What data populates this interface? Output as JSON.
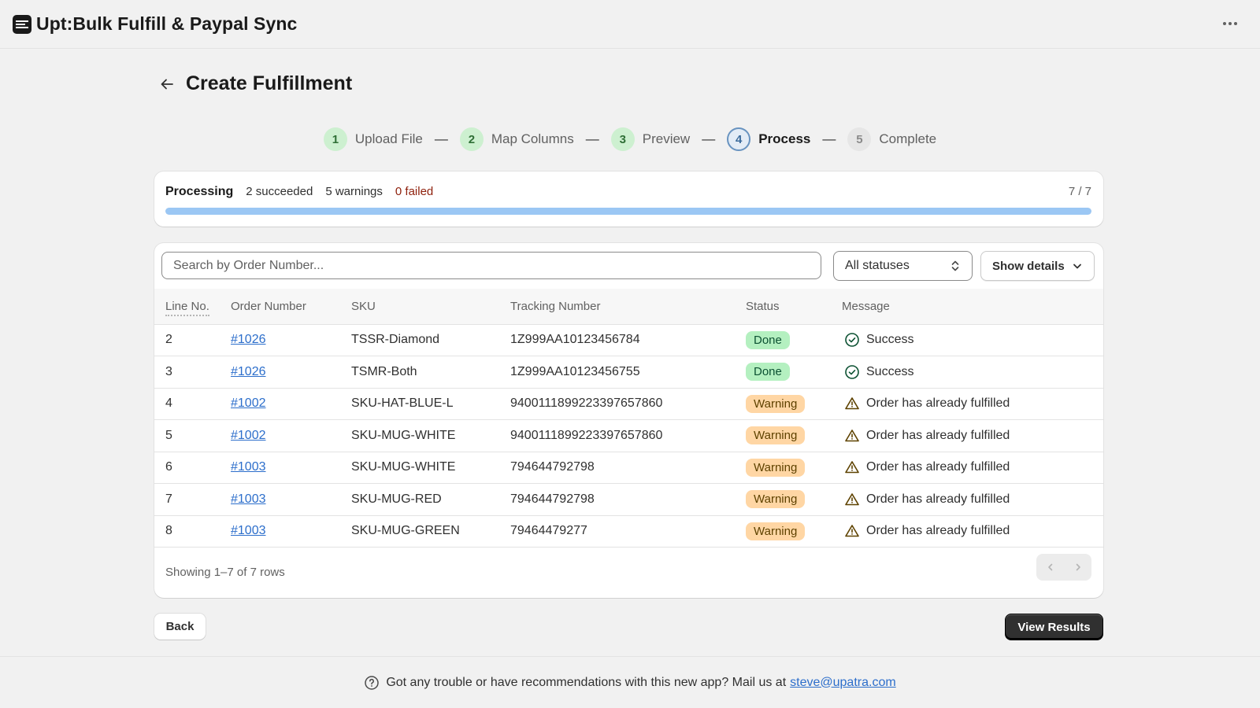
{
  "app": {
    "title": "Upt:Bulk Fulfill & Paypal Sync"
  },
  "page": {
    "title": "Create Fulfillment"
  },
  "stepper": {
    "steps": [
      {
        "number": "1",
        "label": "Upload File",
        "state": "done"
      },
      {
        "number": "2",
        "label": "Map Columns",
        "state": "done"
      },
      {
        "number": "3",
        "label": "Preview",
        "state": "done"
      },
      {
        "number": "4",
        "label": "Process",
        "state": "current"
      },
      {
        "number": "5",
        "label": "Complete",
        "state": "pending"
      }
    ],
    "separator": "—"
  },
  "progress": {
    "title": "Processing",
    "succeeded": "2 succeeded",
    "warnings": "5 warnings",
    "failed": "0 failed",
    "count": "7 / 7",
    "fraction": 1.0
  },
  "search": {
    "placeholder": "Search by Order Number..."
  },
  "filter": {
    "selected": "All statuses"
  },
  "details_button": {
    "label": "Show details"
  },
  "table": {
    "headers": {
      "line": "Line No.",
      "order": "Order Number",
      "sku": "SKU",
      "tracking": "Tracking Number",
      "status": "Status",
      "message": "Message"
    },
    "rows": [
      {
        "line": "2",
        "order": "#1026",
        "sku": "TSSR-Diamond",
        "tracking": "1Z999AA10123456784",
        "status": "Done",
        "status_type": "done",
        "message": "Success"
      },
      {
        "line": "3",
        "order": "#1026",
        "sku": "TSMR-Both",
        "tracking": "1Z999AA10123456755",
        "status": "Done",
        "status_type": "done",
        "message": "Success"
      },
      {
        "line": "4",
        "order": "#1002",
        "sku": "SKU-HAT-BLUE-L",
        "tracking": "9400111899223397657860",
        "status": "Warning",
        "status_type": "warning",
        "message": "Order has already fulfilled"
      },
      {
        "line": "5",
        "order": "#1002",
        "sku": "SKU-MUG-WHITE",
        "tracking": "9400111899223397657860",
        "status": "Warning",
        "status_type": "warning",
        "message": "Order has already fulfilled"
      },
      {
        "line": "6",
        "order": "#1003",
        "sku": "SKU-MUG-WHITE",
        "tracking": "794644792798",
        "status": "Warning",
        "status_type": "warning",
        "message": "Order has already fulfilled"
      },
      {
        "line": "7",
        "order": "#1003",
        "sku": "SKU-MUG-RED",
        "tracking": "794644792798",
        "status": "Warning",
        "status_type": "warning",
        "message": "Order has already fulfilled"
      },
      {
        "line": "8",
        "order": "#1003",
        "sku": "SKU-MUG-GREEN",
        "tracking": "79464479277",
        "status": "Warning",
        "status_type": "warning",
        "message": "Order has already fulfilled"
      }
    ],
    "showing": "Showing 1–7 of 7 rows"
  },
  "actions": {
    "back_label": "Back",
    "view_results_label": "View Results"
  },
  "footer": {
    "text": "Got any trouble or have recommendations with this new app? Mail us at",
    "email": "steve@upatra.com"
  },
  "colors": {
    "accent_link": "#2c6ecb",
    "progress_fill": "#9bc7f4",
    "badge_done": "#b4f0c0",
    "badge_warning": "#ffd6a4",
    "failed_text": "#8e1f0b"
  }
}
